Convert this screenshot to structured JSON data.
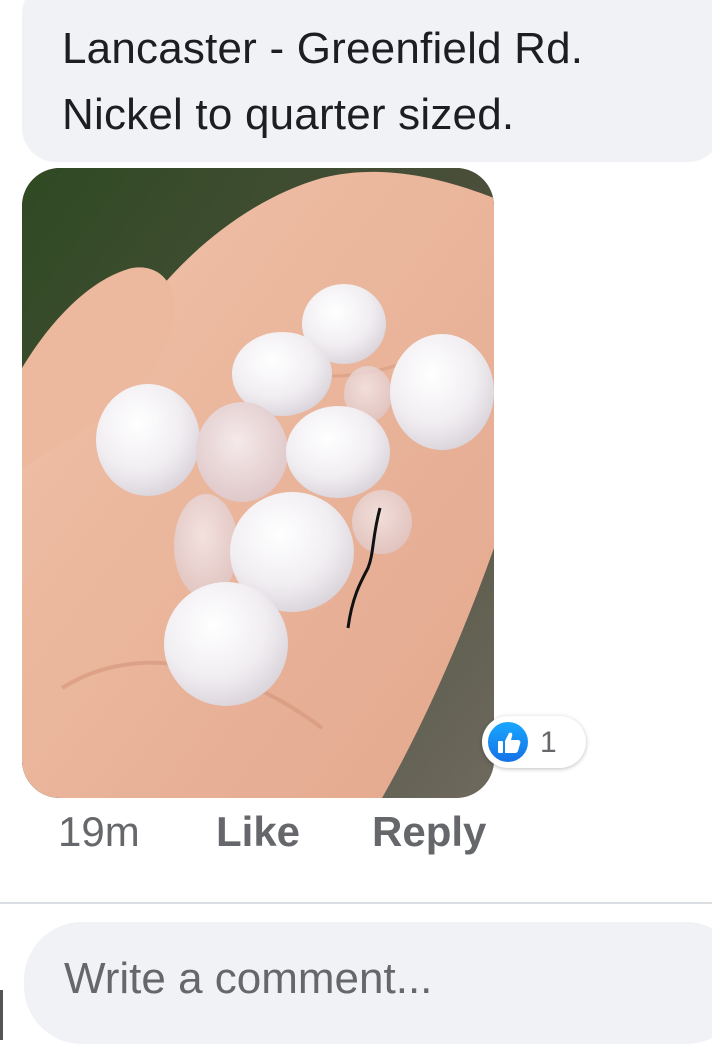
{
  "comment": {
    "lines": [
      "Lancaster - Greenfield Rd.",
      "Nickel to quarter sized."
    ]
  },
  "photo": {
    "description_icon": "hailstones-in-hand-photo"
  },
  "reactions": {
    "icon": "thumbs-up-icon",
    "count": "1",
    "accent_color": "#1877f2"
  },
  "actions": {
    "time": "19m",
    "like_label": "Like",
    "reply_label": "Reply"
  },
  "composer": {
    "placeholder": "Write a comment..."
  }
}
